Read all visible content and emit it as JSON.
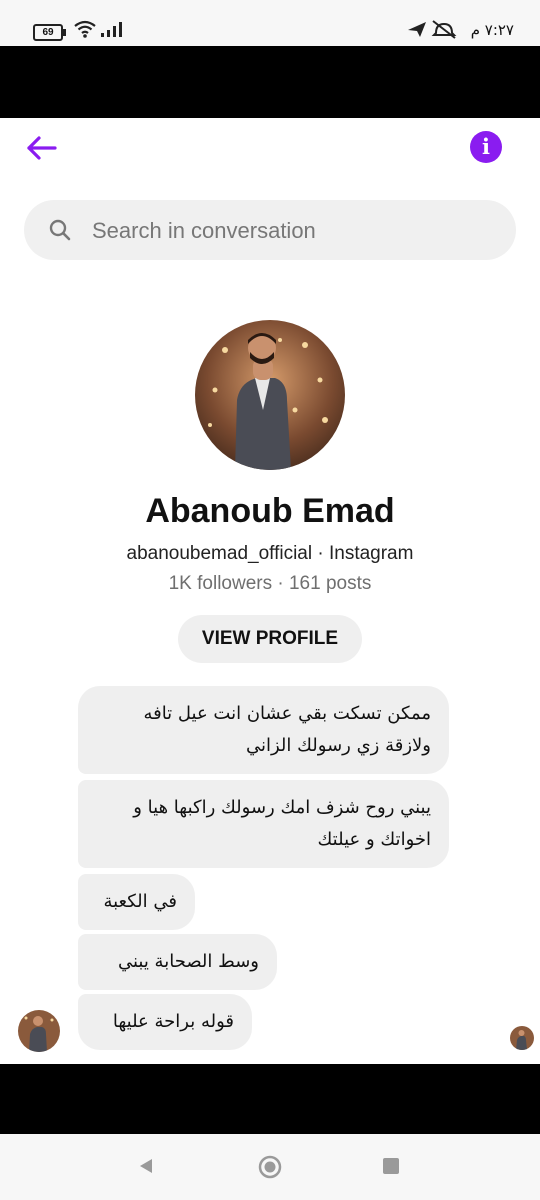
{
  "status_bar": {
    "battery": "69",
    "time": "٧:٢٧ م"
  },
  "search": {
    "placeholder": "Search in conversation"
  },
  "profile": {
    "name": "Abanoub Emad",
    "handle_line": "abanoubemad_official · Instagram",
    "stats": "1K followers · 161 posts",
    "view_profile_label": "VIEW PROFILE"
  },
  "messages": [
    {
      "text": "ممكن تسكت بقي عشان انت عيل تافه ولازقة زي رسولك الزاني"
    },
    {
      "text": "يبني روح شزف امك رسولك راكبها هيا و اخواتك و عيلتك"
    },
    {
      "text": "في الكعبة"
    },
    {
      "text": "وسط الصحابة يبني"
    },
    {
      "text": "قوله براحة عليها"
    }
  ],
  "colors": {
    "accent": "#8a1cf0",
    "bubble": "#efefef"
  },
  "icons": {
    "back": "arrow-left-icon",
    "info": "info-icon",
    "search": "search-icon"
  }
}
